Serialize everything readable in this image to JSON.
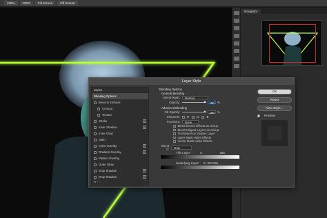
{
  "toolbar": {
    "zoom1": "100%",
    "zoom2": "100%",
    "fit": "Fill Screen",
    "fill": "Fill Screen"
  },
  "navigator": {
    "tab": "Navigator"
  },
  "dialog": {
    "title": "Layer Style",
    "styles_header": "Styles",
    "styles": [
      {
        "label": "Blending Options",
        "check": false,
        "plus": false,
        "active": true
      },
      {
        "label": "Bevel & Emboss",
        "check": true,
        "plus": false
      },
      {
        "label": "Contour",
        "check": true,
        "plus": false,
        "indent": true
      },
      {
        "label": "Texture",
        "check": true,
        "plus": false,
        "indent": true
      },
      {
        "label": "Stroke",
        "check": true,
        "plus": true
      },
      {
        "label": "Inner Shadow",
        "check": true,
        "plus": true
      },
      {
        "label": "Inner Glow",
        "check": true,
        "plus": false
      },
      {
        "label": "Satin",
        "check": true,
        "plus": false
      },
      {
        "label": "Color Overlay",
        "check": true,
        "plus": true
      },
      {
        "label": "Gradient Overlay",
        "check": true,
        "plus": true
      },
      {
        "label": "Pattern Overlay",
        "check": true,
        "plus": false
      },
      {
        "label": "Outer Glow",
        "check": true,
        "plus": false
      },
      {
        "label": "Drop Shadow",
        "check": true,
        "plus": true
      },
      {
        "label": "Drop Shadow",
        "check": true,
        "plus": true
      }
    ],
    "styles_footer": "fx  ↑  ↓",
    "blending": {
      "section": "Blending Options",
      "general": "General Blending",
      "blend_mode_label": "Blend Mode:",
      "blend_mode": "Normal",
      "opacity_label": "Opacity:",
      "opacity": "100",
      "pct": "%",
      "advanced": "Advanced Blending",
      "fill_label": "Fill Opacity:",
      "fill": "100",
      "channels_label": "Channels:",
      "channels": [
        "R",
        "G",
        "B"
      ],
      "knockout_label": "Knockout:",
      "knockout": "None",
      "checks": [
        "Blend Interior Effects as Group",
        "Blend Clipped Layers as Group",
        "Transparency Shapes Layer",
        "Layer Mask Hides Effects",
        "Vector Mask Hides Effects"
      ],
      "blend_if_label": "Blend If:",
      "blend_if": "Gray",
      "this_layer_label": "This Layer:",
      "this_layer_lo": "0",
      "this_layer_hi": "255",
      "underlying_label": "Underlying Layer:",
      "underlying_vals": "0  /  203   255"
    },
    "buttons": {
      "ok": "OK",
      "reset": "Reset",
      "new_style": "New Style...",
      "preview": "Preview"
    }
  },
  "colors": {
    "neon": "#b8ff3a",
    "accent": "#1e6fd0"
  }
}
